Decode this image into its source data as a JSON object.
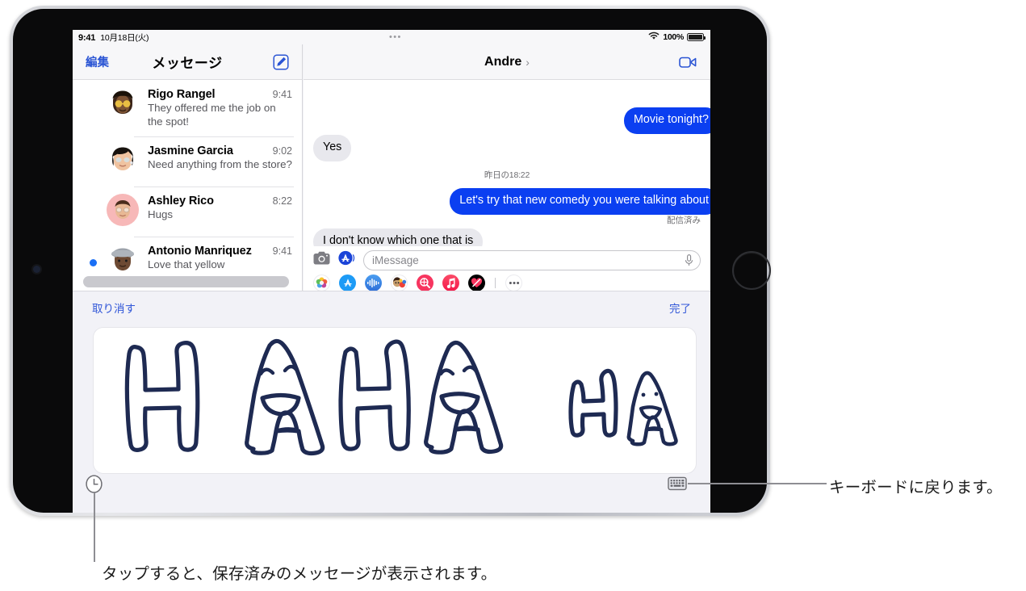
{
  "status_bar": {
    "time": "9:41",
    "date": "10月18日(火)",
    "battery_percent": "100%",
    "wifi_icon": "wifi-icon",
    "battery_icon": "battery-icon",
    "handoff_dots": "•••"
  },
  "sidebar": {
    "edit_label": "編集",
    "title": "メッセージ",
    "compose_icon": "compose-icon",
    "search_placeholder": "",
    "conversations": [
      {
        "name": "Rigo Rangel",
        "time": "9:41",
        "preview": "They offered me the job on the spot!",
        "unread": false,
        "avatar": "memoji-rigo"
      },
      {
        "name": "Jasmine Garcia",
        "time": "9:02",
        "preview": "Need anything from the store?",
        "unread": false,
        "avatar": "memoji-jasmine"
      },
      {
        "name": "Ashley Rico",
        "time": "8:22",
        "preview": "Hugs",
        "unread": false,
        "avatar": "memoji-ashley"
      },
      {
        "name": "Antonio Manriquez",
        "time": "9:41",
        "preview": "Love that yellow",
        "unread": true,
        "avatar": "memoji-antonio"
      }
    ]
  },
  "chat": {
    "title": "Andre",
    "chevron": "›",
    "facetime_icon": "facetime-video-icon",
    "timestamp": "昨日の18:22",
    "delivered_label": "配信済み",
    "messages": [
      {
        "text": "Movie tonight?",
        "side": "me"
      },
      {
        "text": "Yes",
        "side": "them"
      },
      {
        "text": "Let's try that new comedy you were talking about",
        "side": "me"
      },
      {
        "text": "I don't know which one that is",
        "side": "them"
      }
    ],
    "input": {
      "camera_icon": "camera-icon",
      "appstore_icon": "app-store-icon",
      "placeholder": "iMessage",
      "value": "",
      "mic_icon": "microphone-icon"
    },
    "app_drawer": [
      {
        "name": "photos-app-icon",
        "color": "#ffffff"
      },
      {
        "name": "app-store-app-icon",
        "color": "#1d9bf6"
      },
      {
        "name": "audio-message-app-icon",
        "color": "#2f7ce8"
      },
      {
        "name": "memoji-stickers-app-icon",
        "color": "#ffffff"
      },
      {
        "name": "image-search-app-icon",
        "color": "#f7355f"
      },
      {
        "name": "music-app-icon",
        "color": "#fb2c53"
      },
      {
        "name": "digital-touch-app-icon",
        "color": "#000000"
      },
      {
        "name": "more-apps-icon",
        "color": "#ffffff"
      }
    ]
  },
  "drawer": {
    "cancel_label": "取り消す",
    "done_label": "完了",
    "canvas_content": "HA HA HA",
    "ink_color": "#1e2a52",
    "recents_icon": "clock-icon",
    "keyboard_icon": "keyboard-icon"
  },
  "callouts": [
    {
      "id": "keyboard",
      "text": "キーボードに戻ります。"
    },
    {
      "id": "recents",
      "text": "タップすると、保存済みのメッセージが表示されます。"
    }
  ],
  "colors": {
    "imessage_blue": "#0b3ff1",
    "bubble_gray": "#e8e8ed",
    "tint_blue": "#2b55d4",
    "unread_dot": "#1a6ff5"
  }
}
